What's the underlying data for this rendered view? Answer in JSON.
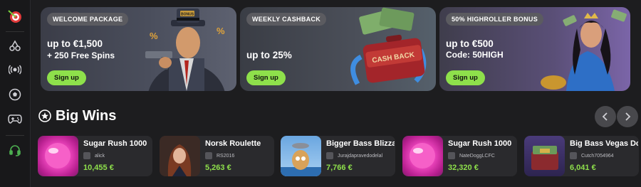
{
  "sidebar": {
    "icons": [
      "dart-target-icon",
      "cherries-icon",
      "broadcast-icon",
      "soccer-ball-icon",
      "gamepad-icon",
      "headset-icon"
    ]
  },
  "promos": [
    {
      "tag": "WELCOME PACKAGE",
      "line1": "up to €1,500",
      "line2": "+ 250 Free Spins",
      "button": "Sign up",
      "art": "gangster-character"
    },
    {
      "tag": "WEEKLY CASHBACK",
      "line1": "up to 25%",
      "line2": "",
      "button": "Sign up",
      "art": "cashback-suitcase"
    },
    {
      "tag": "50% HIGHROLLER BONUS",
      "line1": "up to €500",
      "line2": "Code: 50HIGH",
      "button": "Sign up",
      "art": "queen-character"
    }
  ],
  "big_wins": {
    "title": "Big Wins",
    "icon": "star-badge-icon",
    "items": [
      {
        "game": "Sugar Rush 1000",
        "user": "alick",
        "amount": "10,455 €"
      },
      {
        "game": "Norsk Roulette",
        "user": "RS2016",
        "amount": "5,263 €"
      },
      {
        "game": "Bigger Bass Blizza",
        "user": "Jurajdapravedodelal",
        "amount": "7,766 €"
      },
      {
        "game": "Sugar Rush 1000",
        "user": "NateDoggLCFC",
        "amount": "32,320 €"
      },
      {
        "game": "Big Bass Vegas Do",
        "user": "Cutch7054964",
        "amount": "6,041 €"
      }
    ]
  },
  "colors": {
    "accent": "#8ee04b",
    "background": "#1d1d1f",
    "card": "#2a2a2d"
  }
}
